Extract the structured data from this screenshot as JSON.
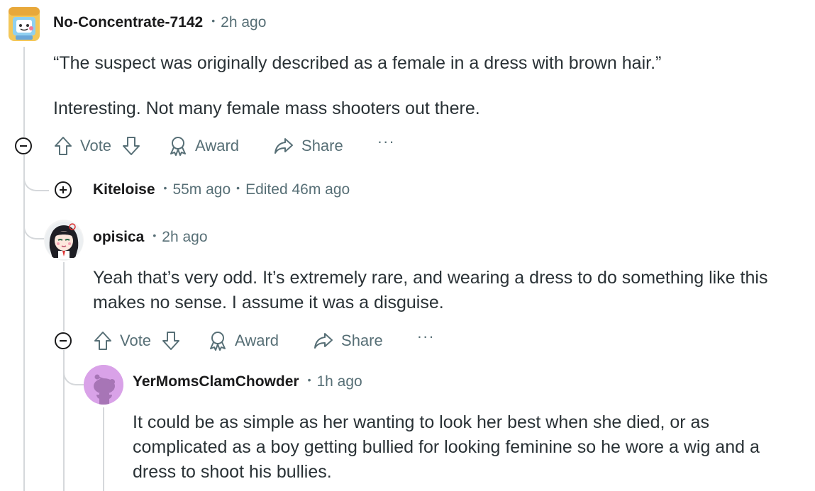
{
  "comments": [
    {
      "username": "No-Concentrate-7142",
      "time": "2h ago",
      "paragraphs": [
        "“The suspect was originally described as a female in a dress with brown hair.”",
        "Interesting. Not many female mass shooters out there."
      ],
      "avatar_icon": "robot-box-avatar"
    },
    {
      "username": "Kiteloise",
      "time": "55m ago",
      "edited": "Edited 46m ago",
      "collapsed": true
    },
    {
      "username": "opisica",
      "time": "2h ago",
      "paragraphs": [
        "Yeah that’s very odd. It’s extremely rare, and wearing a dress to do something like this makes no sense. I assume it was a disguise."
      ],
      "avatar_icon": "anime-girl-avatar"
    },
    {
      "username": "YerMomsClamChowder",
      "time": "1h ago",
      "paragraphs": [
        "It could be as simple as her wanting to look her best when she died, or as complicated as a boy getting bullied for looking feminine so he wore a wig and a dress to shoot his bullies."
      ],
      "avatar_icon": "snoo-avatar"
    }
  ],
  "actions": {
    "vote": "Vote",
    "award": "Award",
    "share": "Share",
    "more": "···"
  },
  "colors": {
    "text": "#1a1a1b",
    "meta": "#576f76",
    "thread_line": "#d5d8db",
    "snoo_bg": "#d9a2e8"
  }
}
